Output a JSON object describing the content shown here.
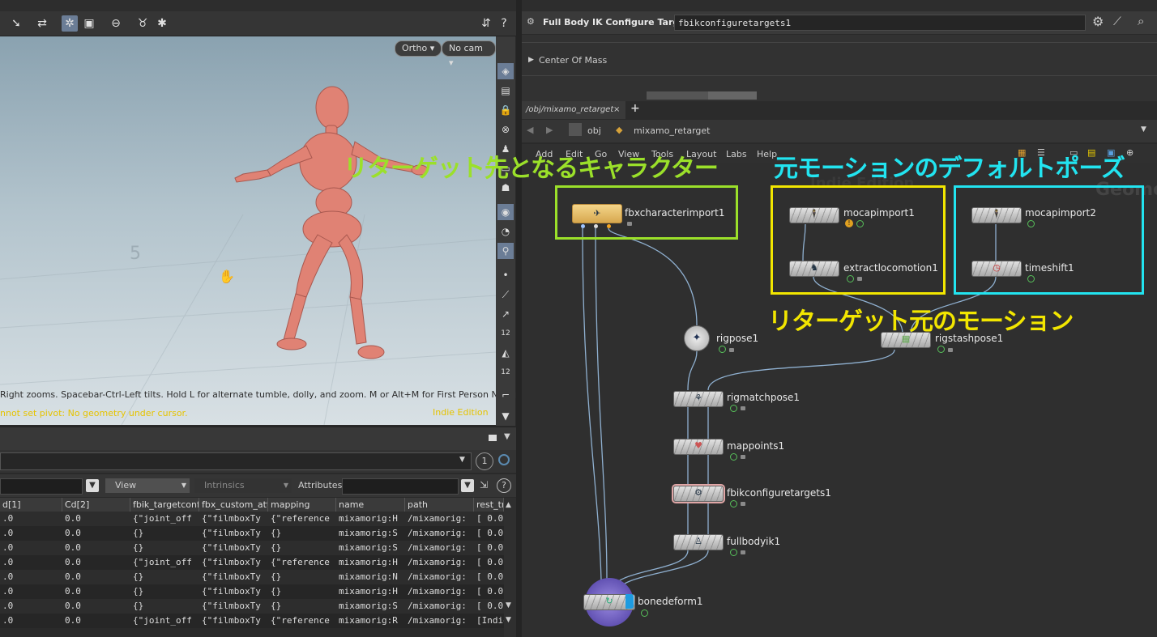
{
  "viewport": {
    "ortho_label": "Ortho",
    "cam_label": "No cam",
    "hint": "Right zooms. Spacebar-Ctrl-Left tilts. Hold L for alternate tumble, dolly, and zoom. M or Alt+M for First Person Navigation.",
    "warning": "nnot set pivot: No geometry under cursor.",
    "edition": "Indie Edition",
    "side_numbers": [
      "12",
      "12"
    ]
  },
  "spreadsheet": {
    "page_num": "1",
    "view_label": "View",
    "intrinsics_label": "Intrinsics",
    "attributes_label": "Attributes:",
    "columns": [
      "d[1]",
      "Cd[2]",
      "fbik_targetconfi",
      "fbx_custom_att",
      "mapping",
      "name",
      "path",
      "rest_tr"
    ],
    "rows": [
      [
        ".0",
        "0.0",
        "{\"joint_off",
        "{\"filmboxTy",
        "{\"reference",
        "mixamorig:H",
        "/mixamorig:",
        "[ 0.0"
      ],
      [
        ".0",
        "0.0",
        "{}",
        "{\"filmboxTy",
        "{}",
        "mixamorig:S",
        "/mixamorig:",
        "[ 0.0"
      ],
      [
        ".0",
        "0.0",
        "{}",
        "{\"filmboxTy",
        "{}",
        "mixamorig:S",
        "/mixamorig:",
        "[ 0.0"
      ],
      [
        ".0",
        "0.0",
        "{\"joint_off",
        "{\"filmboxTy",
        "{\"reference",
        "mixamorig:H",
        "/mixamorig:",
        "[ 0.0"
      ],
      [
        ".0",
        "0.0",
        "{}",
        "{\"filmboxTy",
        "{}",
        "mixamorig:N",
        "/mixamorig:",
        "[ 0.0"
      ],
      [
        ".0",
        "0.0",
        "{}",
        "{\"filmboxTy",
        "{}",
        "mixamorig:H",
        "/mixamorig:",
        "[ 0.0"
      ],
      [
        ".0",
        "0.0",
        "{}",
        "{\"filmboxTy",
        "{}",
        "mixamorig:S",
        "/mixamorig:",
        "[ 0.0"
      ],
      [
        ".0",
        "0.0",
        "{\"joint_off",
        "{\"filmboxTy",
        "{\"reference",
        "mixamorig:R",
        "/mixamorig:",
        "[Indie"
      ]
    ]
  },
  "params": {
    "node_type": "Full Body IK Configure Targets",
    "node_name": "fbikconfiguretargets1",
    "section": "Center Of Mass"
  },
  "network": {
    "tab_label": "/obj/mixamo_retarget",
    "tab_add": "+",
    "path_obj": "obj",
    "path_net": "mixamo_retarget",
    "menu": [
      "Add",
      "Edit",
      "Go",
      "View",
      "Tools",
      "Layout",
      "Labs",
      "Help"
    ],
    "watermark1": "Indie Edition",
    "watermark2": "Geome",
    "nodes": {
      "fbxcharacterimport1": "fbxcharacterimport1",
      "mocapimport1": "mocapimport1",
      "extractlocomotion1": "extractlocomotion1",
      "mocapimport2": "mocapimport2",
      "timeshift1": "timeshift1",
      "rigpose1": "rigpose1",
      "rigstashpose1": "rigstashpose1",
      "rigmatchpose1": "rigmatchpose1",
      "mappoints1": "mappoints1",
      "fbikconfiguretargets1": "fbikconfiguretargets1",
      "fullbodyik1": "fullbodyik1",
      "bonedeform1": "bonedeform1"
    }
  },
  "annotations": {
    "target_character": "リターゲット先となるキャラクター",
    "source_default_pose": "元モーションのデフォルトポーズ",
    "source_motion": "リターゲット元のモーション",
    "colors": {
      "green": "#9be02a",
      "yellow": "#f2e600",
      "cyan": "#22e4f0"
    }
  }
}
